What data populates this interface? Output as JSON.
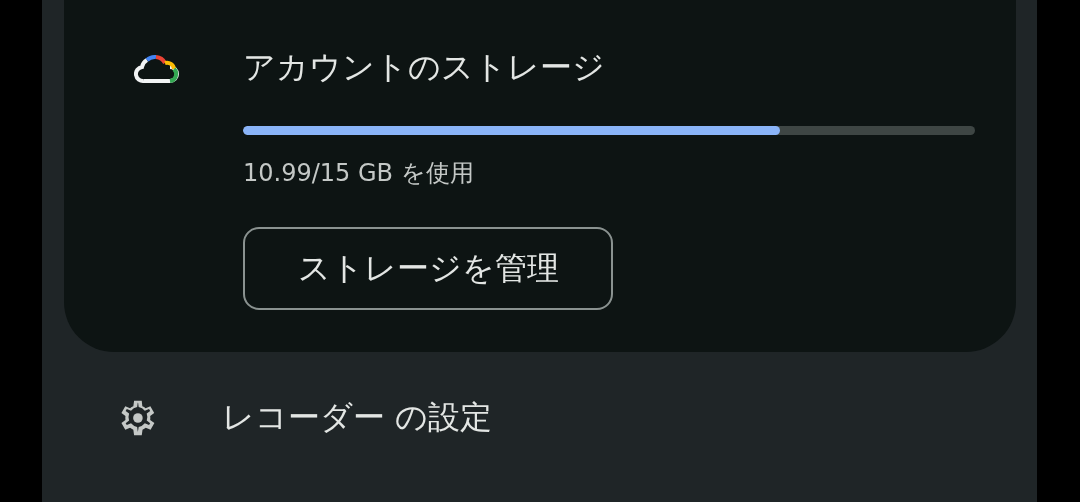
{
  "storage": {
    "title": "アカウントのストレージ",
    "level": 0.733,
    "usage": "10.99/15 GB を使用",
    "button": "ストレージを管理"
  },
  "settings": {
    "label": "レコーダー の設定"
  }
}
